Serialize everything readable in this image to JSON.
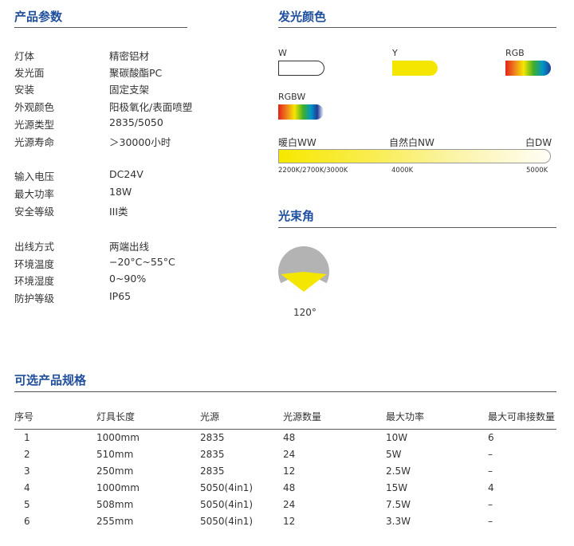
{
  "product_params": {
    "title": "产品参数",
    "group1": [
      {
        "k": "灯体",
        "v": "精密铝材"
      },
      {
        "k": "发光面",
        "v": "聚碳酸酯PC"
      },
      {
        "k": "安装",
        "v": "固定支架"
      },
      {
        "k": "外观颜色",
        "v": "阳极氧化/表面喷塑"
      },
      {
        "k": "光源类型",
        "v": "2835/5050"
      },
      {
        "k": "光源寿命",
        "v": "＞30000小时"
      }
    ],
    "group2": [
      {
        "k": "输入电压",
        "v": "DC24V"
      },
      {
        "k": "最大功率",
        "v": "18W"
      },
      {
        "k": "安全等级",
        "v": "III类"
      }
    ],
    "group3": [
      {
        "k": "出线方式",
        "v": "两端出线"
      },
      {
        "k": "环境温度",
        "v": "−20°C~55°C"
      },
      {
        "k": "环境湿度",
        "v": "0~90%"
      },
      {
        "k": "防护等级",
        "v": "IP65"
      }
    ]
  },
  "light_colors": {
    "title": "发光颜色",
    "w_label": "W",
    "y_label": "Y",
    "rgb_label": "RGB",
    "rgbw_label": "RGBW",
    "warm_label": "暖白WW",
    "natural_label": "自然白NW",
    "cool_label": "白DW",
    "warm_k": "2200K/2700K/3000K",
    "natural_k": "4000K",
    "cool_k": "5000K",
    "colors": {
      "yellow": "#f5e600",
      "blue": "#1f4e9c"
    }
  },
  "beam_angle": {
    "title": "光束角",
    "angle_label": "120°"
  },
  "specs": {
    "title": "可选产品规格",
    "headers": [
      "序号",
      "灯具长度",
      "光源",
      "光源数量",
      "最大功率",
      "最大可串接数量"
    ],
    "rows": [
      [
        "1",
        "1000mm",
        "2835",
        "48",
        "10W",
        "6"
      ],
      [
        "2",
        "510mm",
        "2835",
        "24",
        "5W",
        "–"
      ],
      [
        "3",
        "250mm",
        "2835",
        "12",
        "2.5W",
        "–"
      ],
      [
        "4",
        "1000mm",
        "5050(4in1)",
        "48",
        "15W",
        "4"
      ],
      [
        "5",
        "508mm",
        "5050(4in1)",
        "24",
        "7.5W",
        "–"
      ],
      [
        "6",
        "255mm",
        "5050(4in1)",
        "12",
        "3.3W",
        "–"
      ]
    ]
  }
}
